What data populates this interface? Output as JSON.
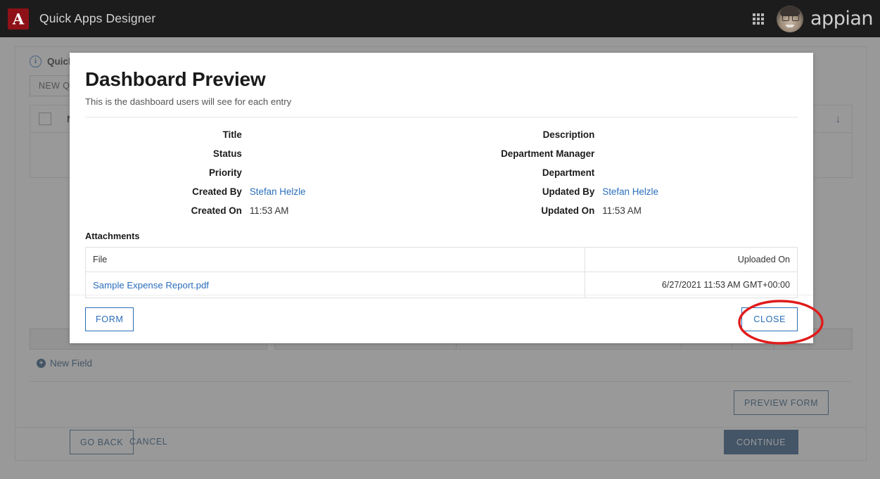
{
  "header": {
    "logo_glyph": "A",
    "logo_icon_name": "appian-compass-logo",
    "app_title": "Quick Apps Designer",
    "grid_icon_name": "app-grid-icon",
    "avatar_name": "user-avatar",
    "wordmark": "appian"
  },
  "background_page": {
    "info_icon": "i",
    "info_text": "Quick",
    "new_quick_button": "NEW QUIC",
    "table": {
      "columns": [
        "Na"
      ],
      "sort_icon": "↓"
    },
    "new_field_label": "New Field",
    "new_field_icon": "plus-circle-icon",
    "preview_form_button": "PREVIEW FORM",
    "go_back_button": "GO BACK",
    "cancel_button": "CANCEL",
    "continue_button": "CONTINUE"
  },
  "modal": {
    "title": "Dashboard Preview",
    "subtitle": "This is the dashboard users will see for each entry",
    "left_fields": [
      {
        "label": "Title",
        "value": "",
        "is_link": false
      },
      {
        "label": "Status",
        "value": "",
        "is_link": false
      },
      {
        "label": "Priority",
        "value": "",
        "is_link": false
      },
      {
        "label": "Created By",
        "value": "Stefan Helzle",
        "is_link": true
      },
      {
        "label": "Created On",
        "value": "11:53 AM",
        "is_link": false
      }
    ],
    "right_fields": [
      {
        "label": "Description",
        "value": "",
        "is_link": false
      },
      {
        "label": "Department Manager",
        "value": "",
        "is_link": false
      },
      {
        "label": "Department",
        "value": "",
        "is_link": false
      },
      {
        "label": "Updated By",
        "value": "Stefan Helzle",
        "is_link": true
      },
      {
        "label": "Updated On",
        "value": "11:53 AM",
        "is_link": false
      }
    ],
    "attachments": {
      "section_title": "Attachments",
      "columns": [
        "File",
        "Uploaded On"
      ],
      "rows": [
        {
          "file": "Sample Expense Report.pdf",
          "uploaded_on": "6/27/2021 11:53 AM GMT+00:00"
        }
      ]
    },
    "footer": {
      "form_button": "FORM",
      "close_button": "CLOSE"
    }
  },
  "annotation": {
    "shape": "ellipse",
    "color": "#e01b1b",
    "target": "CLOSE"
  },
  "colors": {
    "header_bg": "#1c1c1c",
    "logo_red": "#8e1117",
    "link_blue": "#2a6ebb",
    "primary_navy": "#1f4e79",
    "annotation_red": "#e01b1b",
    "overlay": "rgba(90,90,90,0.62)"
  }
}
